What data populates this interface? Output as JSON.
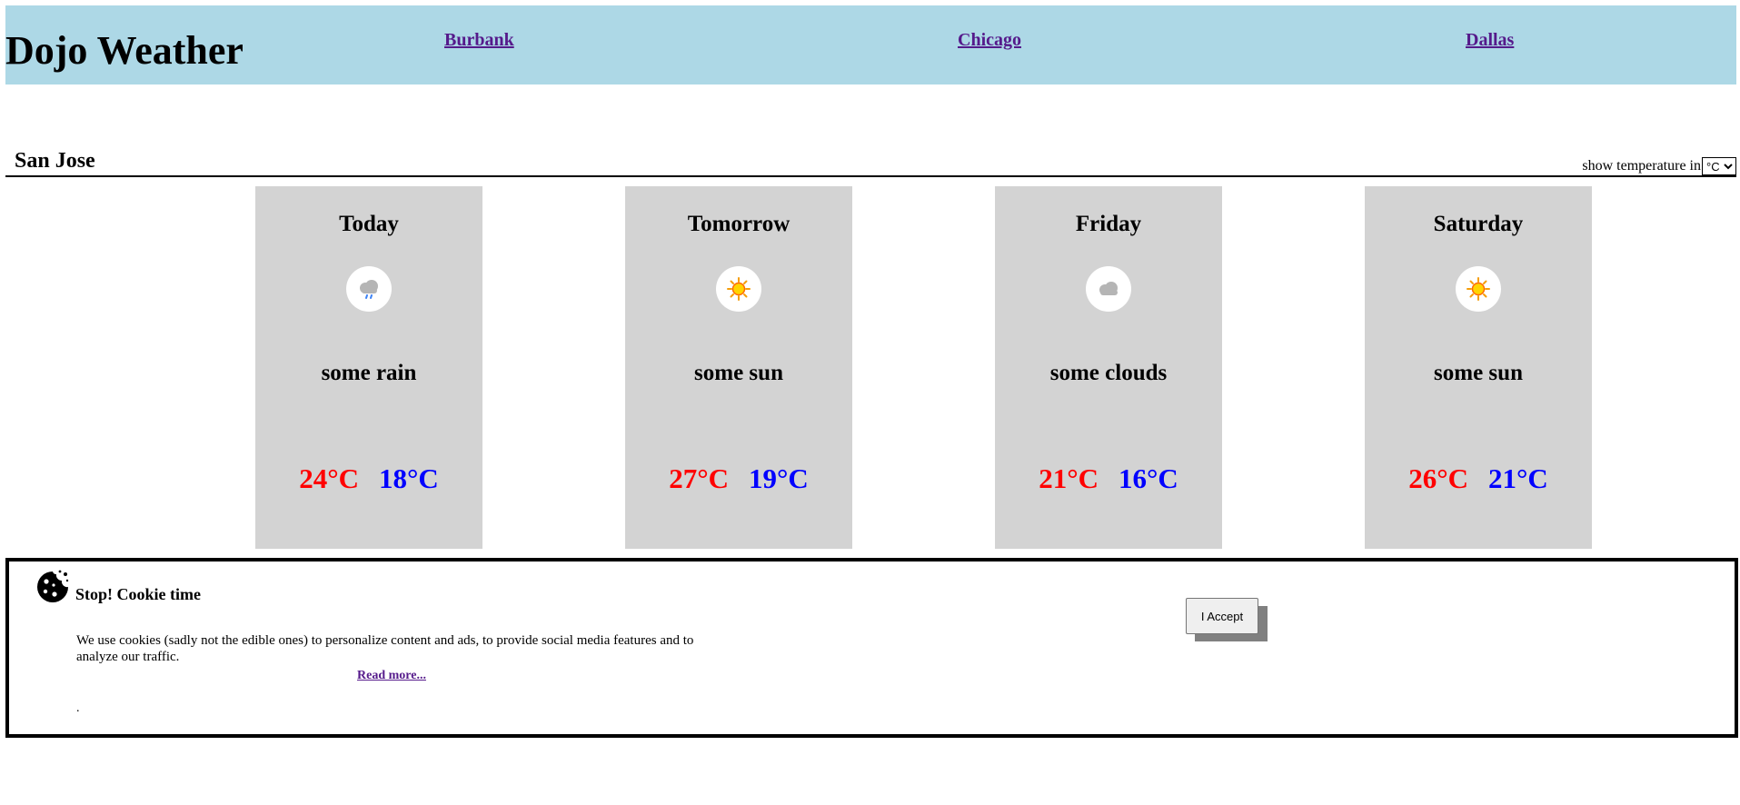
{
  "header": {
    "brand": "Dojo Weather",
    "nav": [
      {
        "label": "Burbank"
      },
      {
        "label": "Chicago"
      },
      {
        "label": "Dallas"
      }
    ]
  },
  "city": {
    "name": "San Jose",
    "unit_label": "show temperature in",
    "unit_selected": "°C"
  },
  "forecast": [
    {
      "day": "Today",
      "icon": "rain-cloud-icon",
      "desc": "some rain",
      "high": "24°C",
      "low": "18°C"
    },
    {
      "day": "Tomorrow",
      "icon": "sun-icon",
      "desc": "some sun",
      "high": "27°C",
      "low": "19°C"
    },
    {
      "day": "Friday",
      "icon": "cloud-icon",
      "desc": "some clouds",
      "high": "21°C",
      "low": "16°C"
    },
    {
      "day": "Saturday",
      "icon": "sun-icon",
      "desc": "some sun",
      "high": "26°C",
      "low": "21°C"
    }
  ],
  "colors": {
    "header_bg": "#add8e6",
    "card_bg": "#d3d3d3",
    "high_temp": "#ff0000",
    "low_temp": "#0000ff"
  },
  "cookie": {
    "icon": "cookie-icon",
    "title": "Stop! Cookie time",
    "text": "We use cookies (sadly not the edible ones) to personalize content and ads, to provide social media features and to analyze our traffic.",
    "read_more": "Read more...",
    "trailing": ".",
    "accept_label": "I Accept"
  }
}
